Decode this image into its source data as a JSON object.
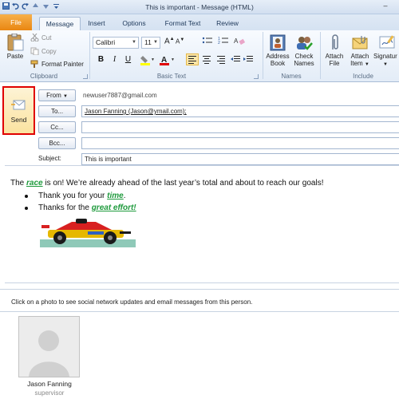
{
  "window": {
    "title": "This is important  -  Message (HTML)",
    "minimize_glyph": "–"
  },
  "quick_access": {
    "icons": [
      "save-icon",
      "undo-icon",
      "redo-icon",
      "up-icon",
      "down-icon",
      "customize-icon"
    ]
  },
  "tabs": {
    "file": "File",
    "message": "Message",
    "insert": "Insert",
    "options": "Options",
    "format_text": "Format Text",
    "review": "Review"
  },
  "clipboard": {
    "paste": "Paste",
    "cut": "Cut",
    "copy": "Copy",
    "format_painter": "Format Painter",
    "group_label": "Clipboard"
  },
  "basic_text": {
    "font": "Calibri",
    "size": "11",
    "group_label": "Basic Text",
    "bold": "B",
    "italic": "I",
    "underline": "U",
    "grow": "A",
    "shrink": "A"
  },
  "names": {
    "address_book_1": "Address",
    "address_book_2": "Book",
    "check_names_1": "Check",
    "check_names_2": "Names",
    "group_label": "Names"
  },
  "include": {
    "attach_file_1": "Attach",
    "attach_file_2": "File",
    "attach_item_1": "Attach",
    "attach_item_2": "Item",
    "signature_1": "Signatur",
    "group_label": "Include"
  },
  "compose": {
    "send": "Send",
    "from_label": "From",
    "from_address": "newuser7887@gmail.com",
    "to_label": "To...",
    "to_value": "Jason Fanning (Jason@ymail.com);",
    "cc_label": "Cc...",
    "bcc_label": "Bcc...",
    "subject_label": "Subject:",
    "subject_value": "This is important"
  },
  "body": {
    "p1_pre": "The ",
    "p1_emph": "race",
    "p1_post": " is on! We’re already ahead of the last year’s total and about to reach our goals!",
    "b1_pre": "Thank you for your ",
    "b1_emph": "time",
    "b1_post": ".",
    "b2_pre": "Thanks for the ",
    "b2_emph": "great effort!"
  },
  "people_pane": {
    "hint": "Click on a photo to see social network updates and email messages from this person.",
    "name": "Jason Fanning",
    "title": "supervisor"
  },
  "colors": {
    "accent": "#e98612",
    "emphasis": "#1e9a3c",
    "send_border": "#e00000"
  }
}
